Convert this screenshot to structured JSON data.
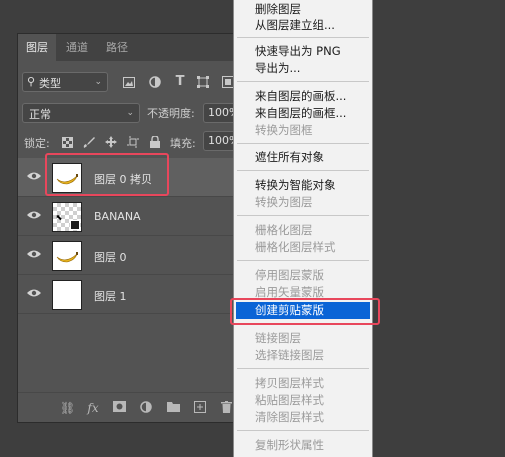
{
  "tabs": [
    "图层",
    "通道",
    "路径"
  ],
  "filter": {
    "kind_label": "类型",
    "icons": [
      "image-filter-icon",
      "adjustment-filter-icon",
      "type-filter-icon",
      "shape-filter-icon",
      "smart-object-filter-icon"
    ]
  },
  "blend": {
    "mode": "正常",
    "opacity_label": "不透明度:",
    "opacity_value": "100%"
  },
  "lock": {
    "label": "锁定:",
    "fill_label": "填充:",
    "fill_value": "100%"
  },
  "layers": [
    {
      "name": "图层 0 拷贝",
      "thumb": "banana",
      "selected": true
    },
    {
      "name": "BANANA",
      "thumb": "text",
      "selected": false
    },
    {
      "name": "图层 0",
      "thumb": "banana",
      "selected": false
    },
    {
      "name": "图层 1",
      "thumb": "white",
      "selected": false
    }
  ],
  "bottom_icons": [
    "link-icon",
    "fx-icon",
    "mask-icon",
    "adjustment-icon",
    "folder-icon",
    "new-layer-icon",
    "trash-icon"
  ],
  "bottom_fx_label": "fx",
  "context_menu": {
    "items": [
      {
        "label": "删除图层",
        "enabled": true
      },
      {
        "label": "从图层建立组...",
        "enabled": true
      },
      {
        "label": "快速导出为 PNG",
        "enabled": true
      },
      {
        "label": "导出为...",
        "enabled": true
      },
      {
        "label": "来自图层的画板...",
        "enabled": true
      },
      {
        "label": "来自图层的画框...",
        "enabled": true
      },
      {
        "label": "转换为图框",
        "enabled": false
      },
      {
        "label": "遮住所有对象",
        "enabled": true
      },
      {
        "label": "转换为智能对象",
        "enabled": true
      },
      {
        "label": "转换为图层",
        "enabled": false
      },
      {
        "label": "栅格化图层",
        "enabled": false
      },
      {
        "label": "栅格化图层样式",
        "enabled": false
      },
      {
        "label": "停用图层蒙版",
        "enabled": false
      },
      {
        "label": "启用矢量蒙版",
        "enabled": false
      },
      {
        "label": "创建剪贴蒙版",
        "enabled": true,
        "highlighted": true
      },
      {
        "label": "链接图层",
        "enabled": false
      },
      {
        "label": "选择链接图层",
        "enabled": false
      },
      {
        "label": "拷贝图层样式",
        "enabled": false
      },
      {
        "label": "粘贴图层样式",
        "enabled": false
      },
      {
        "label": "清除图层样式",
        "enabled": false
      },
      {
        "label": "复制形状属性",
        "enabled": false
      }
    ]
  },
  "colors": {
    "panel_bg": "#535353",
    "menu_bg": "#f2f2f2",
    "highlight": "#0a64d6",
    "annotation_red": "#e8475c"
  }
}
